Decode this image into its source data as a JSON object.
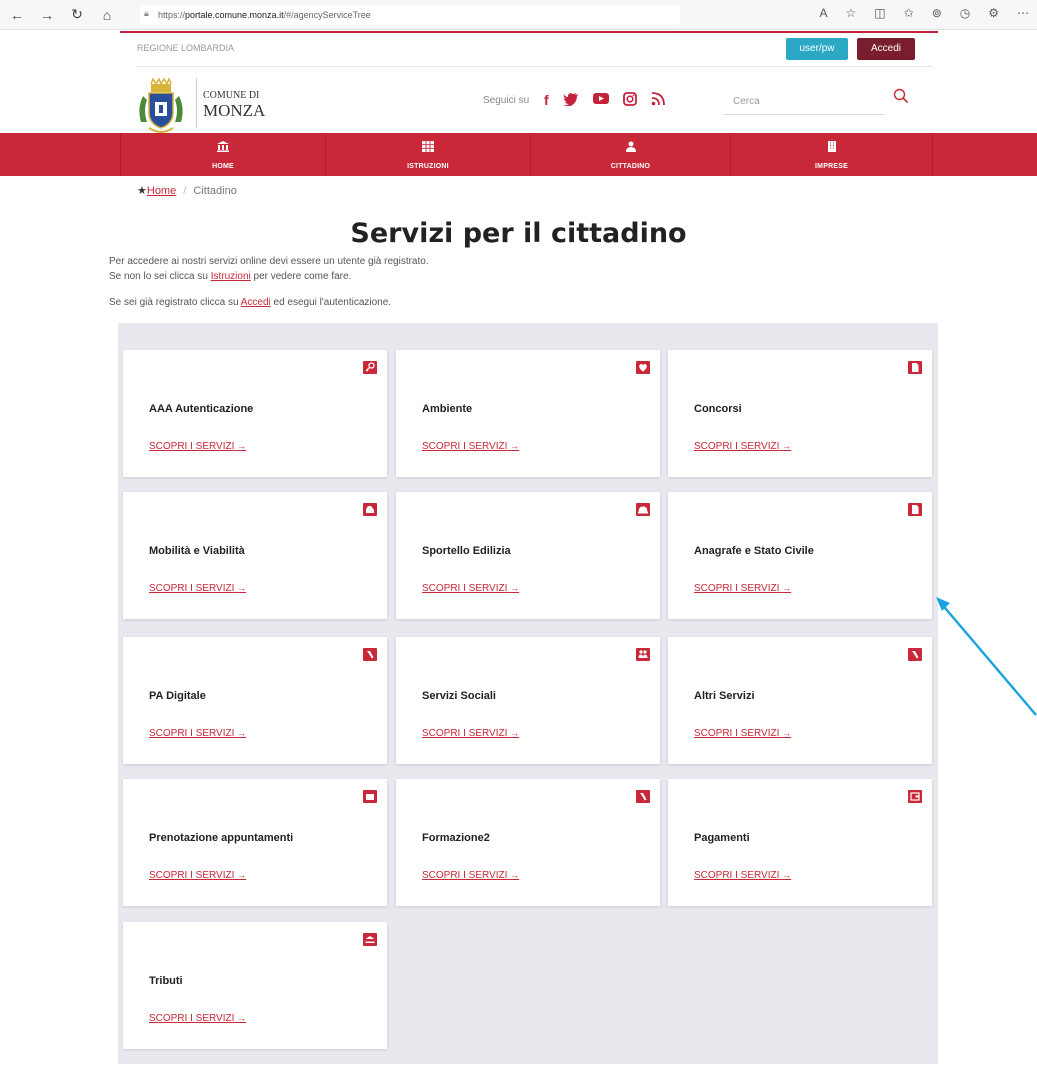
{
  "browser": {
    "url_prefix": "https://",
    "url_host": "portale.comune.monza.it",
    "url_path": "/#/agencyServiceTree"
  },
  "topbar": {
    "region": "REGIONE LOMBARDIA",
    "userpw": "user/pw",
    "login": "Accedi"
  },
  "header": {
    "logo_line1": "COMUNE DI",
    "logo_line2": "MONZA",
    "follow_label": "Seguici su",
    "search_placeholder": "Cerca"
  },
  "nav": {
    "items": [
      {
        "label": "HOME",
        "icon": "bank-icon"
      },
      {
        "label": "ISTRUZIONI",
        "icon": "grid-icon"
      },
      {
        "label": "CITTADINO",
        "icon": "person-icon"
      },
      {
        "label": "IMPRESE",
        "icon": "building-icon"
      }
    ]
  },
  "breadcrumb": {
    "home": "Home",
    "current": "Cittadino",
    "separator": "/"
  },
  "page": {
    "title": "Servizi per il cittadino",
    "intro1": "Per accedere ai nostri servizi online devi essere un utente già registrato.",
    "intro2_pre": "Se non lo sei clicca su ",
    "intro2_link": "Istruzioni",
    "intro2_post": " per vedere come fare.",
    "intro3_pre": "Se sei già registrato clicca su ",
    "intro3_link": "Accedi",
    "intro3_post": " ed esegui l'autenticazione."
  },
  "cards": [
    {
      "title": "AAA Autenticazione",
      "link": "SCOPRI I SERVIZI",
      "arrow": "→",
      "icon": "key-icon"
    },
    {
      "title": "Ambiente",
      "link": "SCOPRI I SERVIZI",
      "arrow": "→",
      "icon": "leaf-icon"
    },
    {
      "title": "Concorsi",
      "link": "SCOPRI I SERVIZI",
      "arrow": "→",
      "icon": "document-icon"
    },
    {
      "title": "Mobilità e Viabilità",
      "link": "SCOPRI I SERVIZI",
      "arrow": "→",
      "icon": "car-icon"
    },
    {
      "title": "Sportello Edilizia",
      "link": "SCOPRI I SERVIZI",
      "arrow": "→",
      "icon": "helmet-icon"
    },
    {
      "title": "Anagrafe e Stato Civile",
      "link": "SCOPRI I SERVIZI",
      "arrow": "→",
      "icon": "document-icon"
    },
    {
      "title": "PA Digitale",
      "link": "SCOPRI I SERVIZI",
      "arrow": "→",
      "icon": "tool-icon"
    },
    {
      "title": "Servizi Sociali",
      "link": "SCOPRI I SERVIZI",
      "arrow": "→",
      "icon": "people-icon"
    },
    {
      "title": "Altri Servizi",
      "link": "SCOPRI I SERVIZI",
      "arrow": "→",
      "icon": "tool-icon"
    },
    {
      "title": "Prenotazione appuntamenti",
      "link": "SCOPRI I SERVIZI",
      "arrow": "→",
      "icon": "calendar-icon"
    },
    {
      "title": "Formazione2",
      "link": "SCOPRI I SERVIZI",
      "arrow": "→",
      "icon": "tool-icon"
    },
    {
      "title": "Pagamenti",
      "link": "SCOPRI I SERVIZI",
      "arrow": "→",
      "icon": "wallet-icon"
    },
    {
      "title": "Tributi",
      "link": "SCOPRI I SERVIZI",
      "arrow": "→",
      "icon": "bank-icon"
    }
  ],
  "colors": {
    "brand_red": "#c82838",
    "dark_red": "#7a1d2e",
    "teal": "#2aa8c4",
    "panel_bg": "#e9e8ef",
    "annotation_arrow": "#1aa3e0"
  }
}
